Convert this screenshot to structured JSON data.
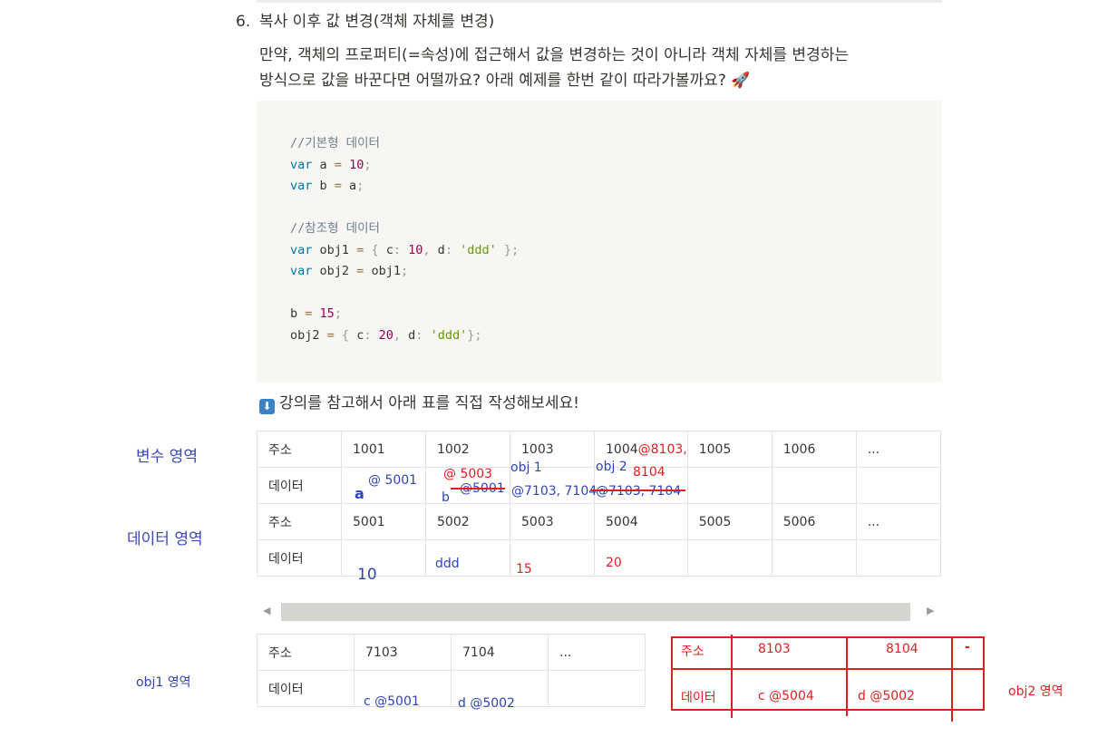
{
  "heading": {
    "number": "6.",
    "title": "복사 이후 값 변경(객체 자체를 변경)"
  },
  "paragraph": {
    "line1": "만약, 객체의 프로퍼티(=속성)에 접근해서 값을 변경하는 것이 아니라 객체 자체를 변경하는",
    "line2": "방식으로 값을 바꾼다면 어떨까요? 아래 예제를 한번 같이 따라가볼까요? 🚀"
  },
  "code": {
    "comment1": "//기본형 데이터",
    "comment2": "//참조형 데이터"
  },
  "note": {
    "icon": "⬇",
    "text": "강의를 참고해서 아래 표를 직접 작성해보세요!"
  },
  "side_labels": {
    "variable_area": "변수 영역",
    "data_area": "데이터 영역",
    "obj1_area": "obj1 영역",
    "obj2_area": "obj2 영역"
  },
  "table1": {
    "row_addr_label": "주소",
    "row_data_label": "데이터",
    "var_addrs": [
      "1001",
      "1002",
      "1003",
      "1004",
      "1005",
      "1006",
      "..."
    ],
    "data_addrs": [
      "5001",
      "5002",
      "5003",
      "5004",
      "5005",
      "5006",
      "..."
    ]
  },
  "annotations": {
    "a": "a",
    "a_val": "@ 5001",
    "b": "b",
    "b_new": "@ 5003",
    "b_old": "@5001",
    "obj1": "obj 1",
    "obj1_val": "@7103, 7104",
    "obj2": "obj 2",
    "obj2_old": "@7103, 7104",
    "obj2_new": "8104",
    "obj2_addr_extra": "@8103,",
    "d5001": "10",
    "d5002": "ddd",
    "d5003": "15",
    "d5004": "20"
  },
  "table2": {
    "addr_label": "주소",
    "data_label": "데이터",
    "addrs": [
      "7103",
      "7104",
      "..."
    ],
    "values": [
      "c @5001",
      "d @5002"
    ]
  },
  "table3": {
    "addr_label": "주소",
    "data_label": "데이터",
    "addrs": [
      "8103",
      "8104",
      "-"
    ],
    "values": [
      "c @5004",
      "d @5002"
    ]
  },
  "colors": {
    "annotation_blue": "#2f44b8",
    "annotation_red": "#e02020"
  }
}
